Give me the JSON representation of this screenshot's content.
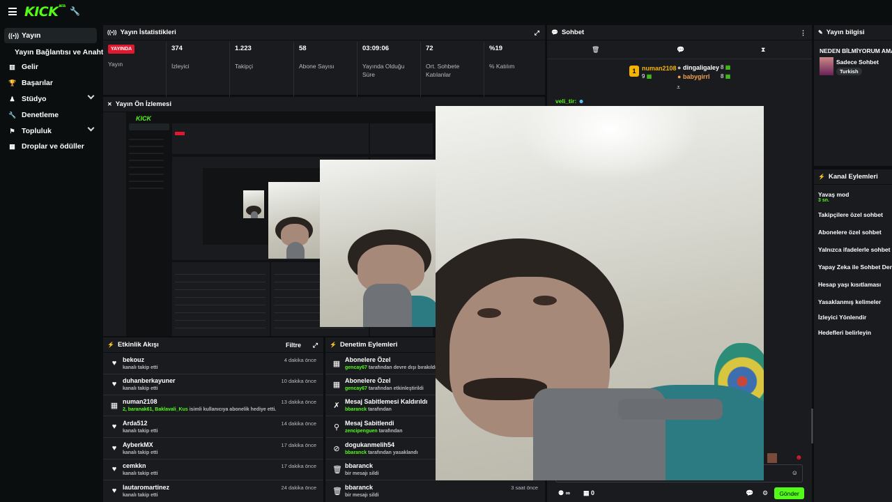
{
  "top": {
    "logo": "KICK",
    "logo_badge": "BETA"
  },
  "sidebar": {
    "items": [
      {
        "label": "Yayın",
        "icon": "broadcast-icon",
        "active": true
      },
      {
        "label": "Yayın Bağlantısı ve Anahtarı",
        "sub": true
      },
      {
        "label": "Gelir",
        "icon": "chart-icon"
      },
      {
        "label": "Başarılar",
        "icon": "trophy-icon"
      },
      {
        "label": "Stüdyo",
        "icon": "studio-icon",
        "expandable": true
      },
      {
        "label": "Denetleme",
        "icon": "wrench-icon"
      },
      {
        "label": "Topluluk",
        "icon": "community-icon",
        "expandable": true
      },
      {
        "label": "Droplar ve ödüller",
        "icon": "gift-icon"
      }
    ]
  },
  "stats": {
    "title": "Yayın İstatistikleri",
    "live_badge": "YAYINDA",
    "live_label": "Yayın",
    "items": [
      {
        "value": "374",
        "label": "İzleyici"
      },
      {
        "value": "1.223",
        "label": "Takipçi"
      },
      {
        "value": "58",
        "label": "Abone Sayısı"
      },
      {
        "value": "03:09:06",
        "label": "Yayında Olduğu Süre"
      },
      {
        "value": "72",
        "label": "Ort. Sohbete Katılanlar"
      },
      {
        "value": "%19",
        "label": "% Katılım"
      }
    ]
  },
  "preview": {
    "title": "Yayın Ön İzlemesi"
  },
  "activity": {
    "title": "Etkinlik Akışı",
    "filter": "Filtre",
    "rows": [
      {
        "name": "bekouz",
        "sub": "kanalı takip etti",
        "time": "4 dakika önce",
        "icon": "heart-icon"
      },
      {
        "name": "duhanberkayuner",
        "sub": "kanalı takip etti",
        "time": "10 dakika önce",
        "icon": "heart-icon"
      },
      {
        "name": "numan2108",
        "sub_green": "2, baranak61, Baklavali_Kus",
        "sub": " isimli kullanıcıya abonelik hediye etti.",
        "time": "13 dakika önce",
        "icon": "gift-icon"
      },
      {
        "name": "Arda512",
        "sub": "kanalı takip etti",
        "time": "14 dakika önce",
        "icon": "heart-icon"
      },
      {
        "name": "AyberkMX",
        "sub": "kanalı takip etti",
        "time": "17 dakika önce",
        "icon": "heart-icon"
      },
      {
        "name": "cemkkn",
        "sub": "kanalı takip etti",
        "time": "17 dakika önce",
        "icon": "heart-icon"
      },
      {
        "name": "lautaromartinez",
        "sub": "kanalı takip etti",
        "time": "24 dakika önce",
        "icon": "heart-icon"
      }
    ]
  },
  "moderation": {
    "title": "Denetim Eylemleri",
    "rows": [
      {
        "name": "Abonelere Özel",
        "user": "gencay67",
        "sub": " tarafından devre dışı bırakıldı",
        "icon": "gift-icon",
        "time": ""
      },
      {
        "name": "Abonelere Özel",
        "user": "gencay67",
        "sub": " tarafından etkinleştirildi",
        "icon": "gift-icon",
        "time": ""
      },
      {
        "name": "Mesaj Sabitlemesi Kaldırıldı",
        "user": "bbaranck",
        "sub": " tarafından",
        "icon": "unpin-icon",
        "time": ""
      },
      {
        "name": "Mesaj Sabitlendi",
        "user": "zencipenguen",
        "sub": " tarafından",
        "icon": "pin-icon",
        "time": ""
      },
      {
        "name": "dogukanmelih54",
        "user": "bbaranck",
        "sub": " tarafından yasaklandı",
        "icon": "ban-icon",
        "time": ""
      },
      {
        "name": "bbaranck",
        "user": "",
        "sub": "bir mesajı sildi",
        "icon": "trash-icon",
        "time": ""
      },
      {
        "name": "bbaranck",
        "user": "",
        "sub": "bir mesajı sildi",
        "icon": "trash-icon",
        "time": "3 saat önce"
      }
    ]
  },
  "chat": {
    "title": "Sohbet",
    "leader": {
      "rank": "1",
      "name": "numan2108",
      "count": "9"
    },
    "gifters": [
      {
        "name": "dingaligaley",
        "count": "8"
      },
      {
        "name": "babygirrl",
        "count": "8"
      }
    ],
    "msg_user": "veli_tir",
    "send": "Gönder",
    "footer_count1": "∞",
    "footer_count2": "0"
  },
  "info": {
    "title": "Yayın bilgisi",
    "stream_title": "NEDEN BİLMİYORUM AMA",
    "category": "Sadece Sohbet",
    "tag": "Turkish"
  },
  "channel": {
    "title": "Kanal Eylemleri",
    "slow_mode": "Yavaş mod",
    "slow_value": "3 sn.",
    "actions": [
      "Takipçilere özel sohbet",
      "Abonelere özel sohbet",
      "Yalnızca ifadelerle sohbet",
      "Yapay Zeka ile Sohbet Denetimi",
      "Hesap yaşı kısıtlaması",
      "Yasaklanmış kelimeler",
      "İzleyici Yönlendir",
      "Hedefleri belirleyin"
    ]
  },
  "colors": {
    "accent": "#53fc18",
    "live": "#e0192f",
    "panel": "#191b1f",
    "bg": "#0b0e0f"
  }
}
